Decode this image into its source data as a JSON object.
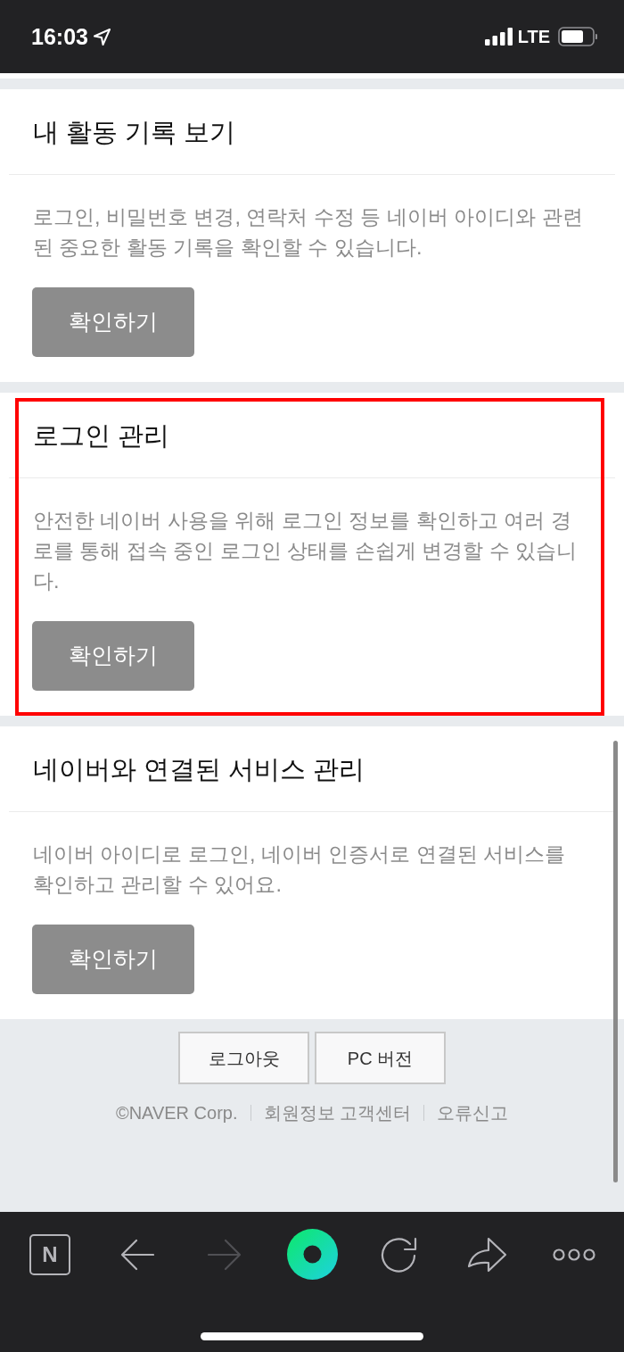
{
  "status_bar": {
    "time": "16:03",
    "network": "LTE"
  },
  "cards": [
    {
      "title": "내 활동 기록 보기",
      "description": "로그인, 비밀번호 변경, 연락처 수정 등 네이버 아이디와 관련된 중요한 활동 기록을 확인할 수 있습니다.",
      "button": "확인하기",
      "highlighted": false
    },
    {
      "title": "로그인 관리",
      "description": "안전한 네이버 사용을 위해 로그인 정보를 확인하고 여러 경로를 통해 접속 중인 로그인 상태를 손쉽게 변경할 수 있습니다.",
      "button": "확인하기",
      "highlighted": true
    },
    {
      "title": "네이버와 연결된 서비스 관리",
      "description": "네이버 아이디로 로그인, 네이버 인증서로 연결된 서비스를 확인하고 관리할 수 있어요.",
      "button": "확인하기",
      "highlighted": false
    }
  ],
  "footer": {
    "buttons": [
      "로그아웃",
      "PC 버전"
    ],
    "copyright": "©NAVER Corp.",
    "links": [
      "회원정보 고객센터",
      "오류신고"
    ]
  },
  "toolbar": [
    {
      "kind": "logo",
      "label": "N",
      "disabled": false
    },
    {
      "kind": "back",
      "disabled": false
    },
    {
      "kind": "forward",
      "disabled": true
    },
    {
      "kind": "ring",
      "disabled": false
    },
    {
      "kind": "reload",
      "disabled": false
    },
    {
      "kind": "share",
      "disabled": false
    },
    {
      "kind": "more",
      "disabled": false
    }
  ]
}
